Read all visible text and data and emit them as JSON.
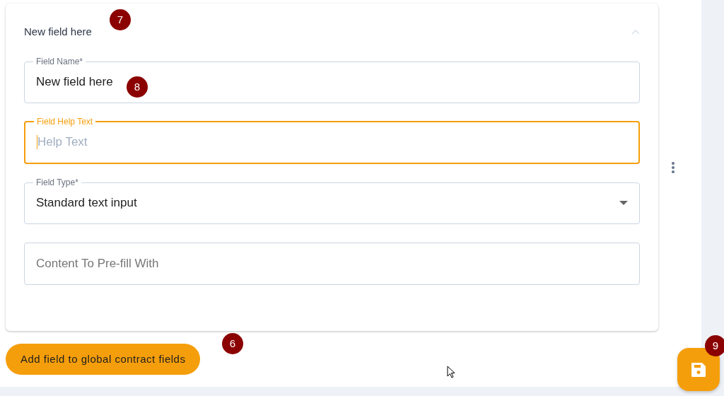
{
  "card": {
    "title": "New field here",
    "marker": "7",
    "expanded": true,
    "fields": [
      {
        "kind": "text",
        "label": "Field Name*",
        "value": "New field here",
        "marker": "8",
        "focused": false
      },
      {
        "kind": "text",
        "label": "Field Help Text",
        "placeholder": "Help Text",
        "focused": true
      },
      {
        "kind": "select",
        "label": "Field Type*",
        "value": "Standard text input",
        "focused": false
      },
      {
        "kind": "text",
        "placeholder": "Content To Pre-fill With",
        "focused": false
      }
    ]
  },
  "add_button": {
    "label": "Add field to global contract fields",
    "marker": "6"
  },
  "save_button": {
    "marker": "9"
  }
}
